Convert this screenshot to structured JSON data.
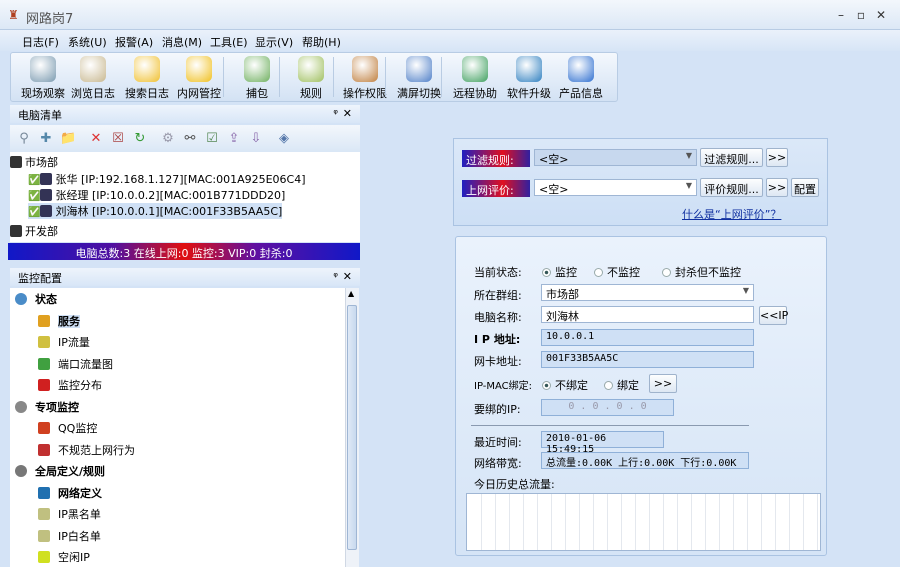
{
  "window": {
    "title": "网路岗7",
    "min": "–",
    "max": "▫",
    "close": "✕"
  },
  "menu": [
    "日志(F)",
    "系统(U)",
    "报警(A)",
    "消息(M)",
    "工具(E)",
    "显示(V)",
    "帮助(H)"
  ],
  "toolbar": [
    {
      "label": "现场观察",
      "icon": "eye-icon",
      "color": "#7a9ab0"
    },
    {
      "label": "浏览日志",
      "icon": "browse-log-icon",
      "color": "#c8b890"
    },
    {
      "label": "搜索日志",
      "icon": "search-log-icon",
      "color": "#f0c030"
    },
    {
      "label": "内网管控",
      "icon": "lan-control-icon",
      "color": "#f0c020"
    },
    {
      "label": "捕包",
      "icon": "capture-icon",
      "color": "#70b060"
    },
    {
      "label": "规则",
      "icon": "rules-icon",
      "color": "#a0c060"
    },
    {
      "label": "操作权限",
      "icon": "permissions-icon",
      "color": "#c08040"
    },
    {
      "label": "满屏切换",
      "icon": "fullscreen-icon",
      "color": "#5080c8"
    },
    {
      "label": "远程协助",
      "icon": "remote-assist-icon",
      "color": "#40a060"
    },
    {
      "label": "软件升级",
      "icon": "upgrade-icon",
      "color": "#3080c0"
    },
    {
      "label": "产品信息",
      "icon": "help-icon",
      "color": "#3070d0"
    }
  ],
  "pc_panel": {
    "title": "电脑清单",
    "pin": "ᵠ",
    "close": "✕",
    "tools": [
      "search-pc-icon",
      "add-pc-icon",
      "add-folder-icon",
      "delete-icon",
      "remove-icon",
      "refresh-icon",
      "settings-icon",
      "find-icon",
      "check-icon",
      "import-icon",
      "export-icon",
      "info-icon"
    ],
    "groups": [
      {
        "name": "市场部",
        "pcs": [
          {
            "name": "张华",
            "ip": "192.168.1.127",
            "mac": "001A925E06C4"
          },
          {
            "name": "张经理",
            "ip": "10.0.0.2",
            "mac": "001B771DDD20"
          },
          {
            "name": "刘海林",
            "ip": "10.0.0.1",
            "mac": "001F33B5AA5C"
          }
        ]
      },
      {
        "name": "开发部",
        "pcs": []
      }
    ],
    "status": "电脑总数:3 在线上网:0 监控:3 VIP:0 封杀:0"
  },
  "cfg_panel": {
    "title": "监控配置",
    "pin": "ᵠ",
    "close": "✕",
    "groups": [
      {
        "name": "状态",
        "items": [
          "服务",
          "IP流量",
          "端口流量图",
          "监控分布"
        ]
      },
      {
        "name": "专项监控",
        "items": [
          "QQ监控",
          "不规范上网行为"
        ]
      },
      {
        "name": "全局定义/规则",
        "items": [
          "网络定义",
          "IP黑名单",
          "IP白名单",
          "空闲IP"
        ]
      }
    ]
  },
  "filter": {
    "filter_label": "过滤规则:",
    "filter_value": "<空>",
    "filter_btn": "过滤规则...",
    "more": ">>",
    "eval_label": "上网评价:",
    "eval_value": "<空>",
    "eval_btn": "评价规则...",
    "config_btn": "配置",
    "link": "什么是“上网评价”？"
  },
  "detail": {
    "state_label": "当前状态:",
    "state_options": [
      "监控",
      "不监控",
      "封杀但不监控"
    ],
    "group_label": "所在群组:",
    "group_value": "市场部",
    "name_label": "电脑名称:",
    "name_value": "刘海林",
    "ip_btn": "<<IP",
    "ip_label": "I P 地址:",
    "ip_value": "10.0.0.1",
    "mac_label": "网卡地址:",
    "mac_value": "001F33B5AA5C",
    "bind_label": "IP-MAC绑定:",
    "bind_options": [
      "不绑定",
      "绑定"
    ],
    "bind_btn": ">>",
    "bindip_label": "要绑的IP:",
    "bindip_value": "0 . 0 . 0 . 0",
    "time_label": "最近时间:",
    "time_value": "2010-01-06 15:49:15",
    "bw_label": "网络带宽:",
    "bw_value": "总流量:0.00K 上行:0.00K 下行:0.00K",
    "hist_label": "今日历史总流量:"
  }
}
